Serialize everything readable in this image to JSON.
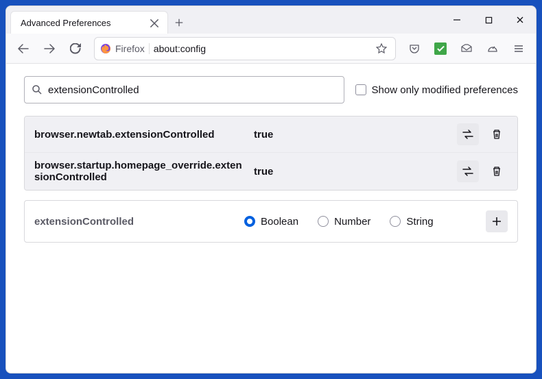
{
  "window": {
    "tab_title": "Advanced Preferences"
  },
  "toolbar": {
    "identity_label": "Firefox",
    "url": "about:config"
  },
  "search": {
    "value": "extensionControlled",
    "checkbox_label": "Show only modified preferences"
  },
  "prefs": [
    {
      "name": "browser.newtab.extensionControlled",
      "value": "true"
    },
    {
      "name": "browser.startup.homepage_override.extensionControlled",
      "value": "true"
    }
  ],
  "add": {
    "name": "extensionControlled",
    "types": {
      "boolean": "Boolean",
      "number": "Number",
      "string": "String"
    }
  }
}
